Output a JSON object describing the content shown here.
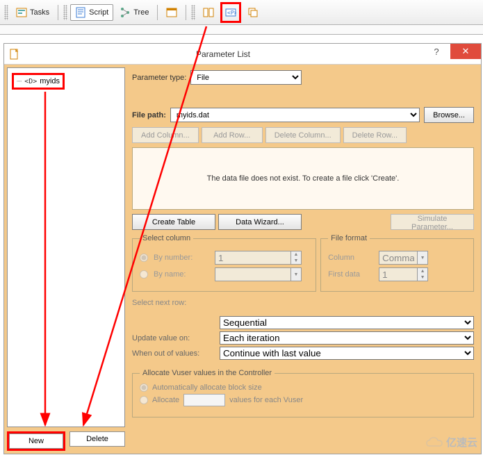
{
  "toolbar": {
    "tasks": "Tasks",
    "script": "Script",
    "tree": "Tree"
  },
  "dialog": {
    "title": "Parameter List",
    "param_name": "myids",
    "param_type_label": "Parameter type:",
    "param_type_value": "File",
    "file_path_label": "File path:",
    "file_path_value": "myids.dat",
    "browse": "Browse...",
    "add_column": "Add Column...",
    "add_row": "Add Row...",
    "delete_column": "Delete Column...",
    "delete_row": "Delete Row...",
    "data_msg": "The data file does not exist. To create a file click 'Create'.",
    "create_table": "Create Table",
    "data_wizard": "Data Wizard...",
    "simulate": "Simulate Parameter...",
    "select_column": {
      "legend": "Select column",
      "by_number": "By number:",
      "by_number_val": "1",
      "by_name": "By name:"
    },
    "file_format": {
      "legend": "File format",
      "column": "Column",
      "column_val": "Comma",
      "first_data": "First data",
      "first_data_val": "1"
    },
    "select_next_row": "Select next row:",
    "next_row_val": "Sequential",
    "update_on": "Update value on:",
    "update_on_val": "Each iteration",
    "out_of_values": "When out of values:",
    "out_of_values_val": "Continue with last value",
    "allocate": {
      "legend": "Allocate Vuser values in the Controller",
      "auto": "Automatically allocate block size",
      "manual": "Allocate",
      "suffix": "values for each Vuser"
    },
    "new": "New",
    "delete": "Delete"
  },
  "watermark": "亿速云"
}
